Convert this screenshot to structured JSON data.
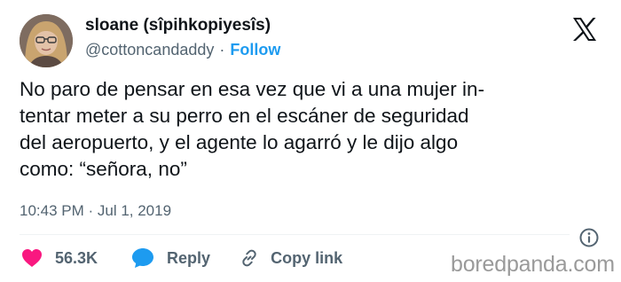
{
  "author": {
    "display_name": "sloane (sîpihkopiyesîs)",
    "handle": "@cottoncandaddy",
    "separator": "·",
    "follow_label": "Follow",
    "avatar_icon": "profile-photo"
  },
  "header": {
    "logo_icon": "x-logo-icon"
  },
  "tweet": {
    "text": "No paro de pensar en esa vez que vi a una mujer in-\ntentar meter a su perro en el escáner de seguridad\ndel aeropuerto, y el agente lo agarró y le dijo algo\ncomo: “señora, no”",
    "timestamp": "10:43 PM · Jul 1, 2019",
    "info_icon": "info-icon"
  },
  "actions": {
    "like": {
      "icon": "heart-icon",
      "count": "56.3K",
      "color": "#f91880"
    },
    "reply": {
      "icon": "speech-bubble-icon",
      "label": "Reply",
      "color": "#1d9bf0"
    },
    "copy_link": {
      "icon": "link-icon",
      "label": "Copy link"
    }
  },
  "watermark": "boredpanda.com"
}
